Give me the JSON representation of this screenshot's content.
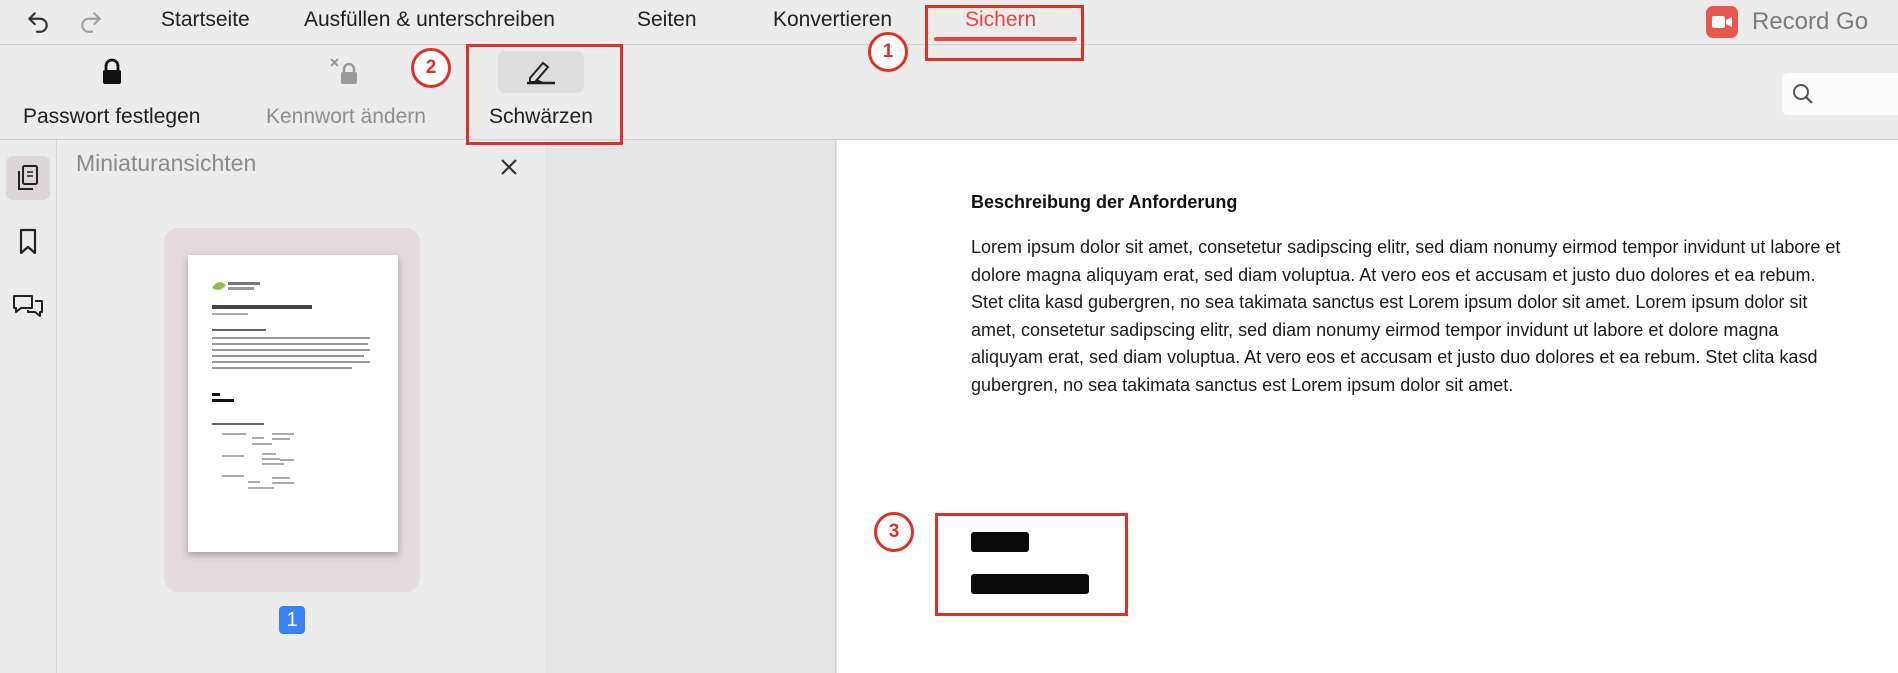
{
  "menu": {
    "items": [
      {
        "label": "Startseite"
      },
      {
        "label": "Ausfüllen & unterschreiben"
      },
      {
        "label": "Seiten"
      },
      {
        "label": "Konvertieren"
      },
      {
        "label": "Sichern",
        "active": true
      }
    ],
    "record_label": "Record Go"
  },
  "ribbon": {
    "tools": [
      {
        "label": "Passwort festlegen",
        "enabled": true
      },
      {
        "label": "Kennwort ändern",
        "enabled": false
      },
      {
        "label": "Schwärzen",
        "enabled": true,
        "selected": true
      }
    ]
  },
  "sidebar": {
    "icons": [
      "pages-icon",
      "bookmark-icon",
      "comments-icon"
    ]
  },
  "thumbnails": {
    "title": "Miniaturansichten",
    "page_number": "1"
  },
  "document": {
    "heading": "Beschreibung der Anforderung",
    "paragraph": "Lorem ipsum dolor sit amet, consetetur sadipscing elitr, sed diam nonumy eirmod tempor invidunt ut labore et dolore magna aliquyam erat, sed diam voluptua. At vero eos et accusam et justo duo dolores et ea rebum. Stet clita kasd gubergren, no sea takimata sanctus est Lorem ipsum dolor sit amet. Lorem ipsum dolor sit amet, consetetur sadipscing elitr, sed diam nonumy eirmod tempor invidunt ut labore et dolore magna aliquyam erat, sed diam voluptua. At vero eos et accusam et justo duo dolores et ea rebum. Stet clita kasd gubergren, no sea takimata sanctus est Lorem ipsum dolor sit amet."
  },
  "annotations": [
    "1",
    "2",
    "3"
  ],
  "colors": {
    "accent": "#e8473d",
    "annotation": "#e0302a",
    "page_badge": "#3b82f6"
  }
}
